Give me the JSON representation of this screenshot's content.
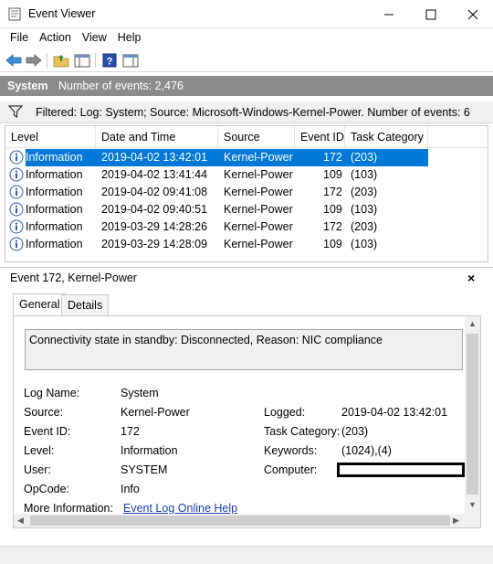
{
  "window": {
    "title": "Event Viewer",
    "minimize_icon": "minimize-icon",
    "maximize_icon": "maximize-icon",
    "close_icon": "close-icon"
  },
  "menu": [
    "File",
    "Action",
    "View",
    "Help"
  ],
  "toolbar": {
    "icons": [
      "back-arrow-icon",
      "forward-arrow-icon",
      "folder-up-icon",
      "show-hide-console-tree-icon",
      "help-icon",
      "show-hide-action-pane-icon"
    ]
  },
  "header": {
    "log_name": "System",
    "count": "Number of events: 2,476"
  },
  "filter": {
    "text": "Filtered: Log: System; Source: Microsoft-Windows-Kernel-Power. Number of events: 6"
  },
  "columns": [
    "Level",
    "Date and Time",
    "Source",
    "Event ID",
    "Task Category"
  ],
  "rows": [
    {
      "level": "Information",
      "datetime": "2019-04-02 13:42:01",
      "source": "Kernel-Power",
      "event_id": "172",
      "task": "(203)",
      "selected": true
    },
    {
      "level": "Information",
      "datetime": "2019-04-02 13:41:44",
      "source": "Kernel-Power",
      "event_id": "109",
      "task": "(103)"
    },
    {
      "level": "Information",
      "datetime": "2019-04-02 09:41:08",
      "source": "Kernel-Power",
      "event_id": "172",
      "task": "(203)"
    },
    {
      "level": "Information",
      "datetime": "2019-04-02 09:40:51",
      "source": "Kernel-Power",
      "event_id": "109",
      "task": "(103)"
    },
    {
      "level": "Information",
      "datetime": "2019-03-29 14:28:26",
      "source": "Kernel-Power",
      "event_id": "172",
      "task": "(203)"
    },
    {
      "level": "Information",
      "datetime": "2019-03-29 14:28:09",
      "source": "Kernel-Power",
      "event_id": "109",
      "task": "(103)"
    }
  ],
  "detail": {
    "title": "Event 172, Kernel-Power",
    "close": "×",
    "tabs": [
      "General",
      "Details"
    ],
    "active_tab": "General",
    "description": "Connectivity state in standby: Disconnected, Reason: NIC compliance",
    "labels": {
      "log_name": "Log Name:",
      "source": "Source:",
      "event_id": "Event ID:",
      "level": "Level:",
      "user": "User:",
      "opcode": "OpCode:",
      "more_info": "More Information:",
      "logged": "Logged:",
      "task_category": "Task Category:",
      "keywords": "Keywords:",
      "computer": "Computer:"
    },
    "values": {
      "log_name": "System",
      "source": "Kernel-Power",
      "event_id": "172",
      "level": "Information",
      "user": "SYSTEM",
      "opcode": "Info",
      "more_info": "Event Log Online Help",
      "logged": "2019-04-02 13:42:01",
      "task_category": "(203)",
      "keywords": "(1024),(4)",
      "computer": ""
    }
  },
  "colors": {
    "selection": "#0078d7",
    "header_strip": "#8c8c8c",
    "link": "#1a3fb1"
  }
}
